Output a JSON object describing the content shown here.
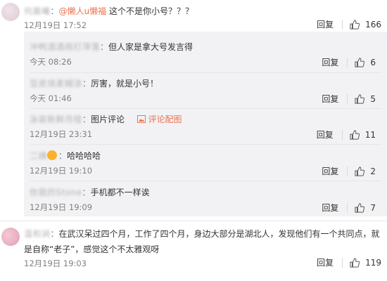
{
  "comments": [
    {
      "user": "何晨曦",
      "colon": "：",
      "mention": "@懒人u懒福",
      "text": "这个不是你小号？？？",
      "time": "12月19日 17:52",
      "reply": "回复",
      "likes": "166"
    },
    {
      "user": "温和涧",
      "colon": "：",
      "text": "在武汉呆过四个月，工作了四个月，身边大部分是湖北人，发现他们有一个共同点，就是自称“老子”，感觉这个不太雅观呀",
      "time": "12月19日 19:03",
      "reply": "回复",
      "likes": "119"
    }
  ],
  "replies": [
    {
      "user": "冲鸭酒酒雨打萍落",
      "colon": "：",
      "text": "但人家是拿大号发言得",
      "time": "今天 08:26",
      "reply": "回复",
      "likes": "6"
    },
    {
      "user": "豆皮烧麦糊涂",
      "colon": "：",
      "text": "厉害，就是小号！",
      "time": "今天 01:46",
      "reply": "回复",
      "likes": "5"
    },
    {
      "user": "泳装新鲜月桂",
      "colon": "：",
      "text": "图片评论",
      "image_link": "评论配图",
      "time": "12月19日 23:31",
      "reply": "回复",
      "likes": "11"
    },
    {
      "user": "二姨",
      "colon": "：",
      "text": "哈哈哈哈",
      "time": "12月19日 19:10",
      "reply": "回复",
      "likes": "2"
    },
    {
      "user": "你我的Stone",
      "colon": "：",
      "text": "手机都不一样诶",
      "time": "12月19日 19:09",
      "reply": "回复",
      "likes": "7"
    }
  ],
  "icons": {
    "like": "thumbs-up-icon",
    "image": "image-icon"
  },
  "colors": {
    "link": "#eb7350",
    "subbox": "#f2f2f5",
    "muted": "#808080"
  }
}
